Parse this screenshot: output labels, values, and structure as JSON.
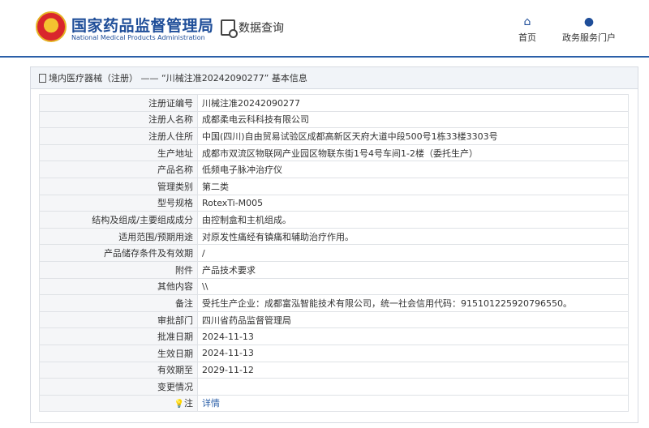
{
  "header": {
    "brand_cn": "国家药品监督管理局",
    "brand_en": "National Medical Products Administration",
    "query_label": "数据查询",
    "nav": {
      "home": "首页",
      "portal": "政务服务门户"
    }
  },
  "panel": {
    "title": "境内医疗器械（注册） —— “川械注准20242090277” 基本信息"
  },
  "fields": [
    {
      "label": "注册证编号",
      "value": "川械注准20242090277"
    },
    {
      "label": "注册人名称",
      "value": "成都柔电云科科技有限公司"
    },
    {
      "label": "注册人住所",
      "value": "中国(四川)自由贸易试验区成都高新区天府大道中段500号1栋33楼3303号"
    },
    {
      "label": "生产地址",
      "value": "成都市双流区物联网产业园区物联东街1号4号车间1-2楼（委托生产）"
    },
    {
      "label": "产品名称",
      "value": "低频电子脉冲治疗仪"
    },
    {
      "label": "管理类别",
      "value": "第二类"
    },
    {
      "label": "型号规格",
      "value": "RotexTi-M005"
    },
    {
      "label": "结构及组成/主要组成成分",
      "value": "由控制盒和主机组成。"
    },
    {
      "label": "适用范围/预期用途",
      "value": "对原发性痛经有镇痛和辅助治疗作用。"
    },
    {
      "label": "产品储存条件及有效期",
      "value": "/"
    },
    {
      "label": "附件",
      "value": "产品技术要求"
    },
    {
      "label": "其他内容",
      "value": "\\\\"
    },
    {
      "label": "备注",
      "value": "受托生产企业：成都富泓智能技术有限公司，统一社会信用代码：915101225920796550。"
    },
    {
      "label": "审批部门",
      "value": "四川省药品监督管理局"
    },
    {
      "label": "批准日期",
      "value": "2024-11-13"
    },
    {
      "label": "生效日期",
      "value": "2024-11-13"
    },
    {
      "label": "有效期至",
      "value": "2029-11-12"
    },
    {
      "label": "变更情况",
      "value": ""
    }
  ],
  "note_row": {
    "label": "注",
    "link": "详情"
  },
  "colors": {
    "brand_blue": "#1f4e99",
    "link_blue": "#2b5fa8",
    "label_bg": "#f5f6f8"
  }
}
